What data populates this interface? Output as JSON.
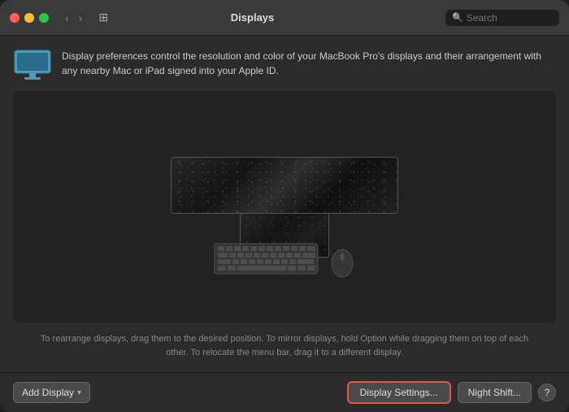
{
  "window": {
    "title": "Displays",
    "search_placeholder": "Search"
  },
  "info_banner": {
    "text": "Display preferences control the resolution and color of your MacBook Pro's displays and their arrangement with any nearby Mac or iPad signed into your Apple ID."
  },
  "instructions": {
    "text": "To rearrange displays, drag them to the desired position. To mirror displays, hold Option while dragging them on top of each other. To relocate the menu bar, drag it to a different display."
  },
  "buttons": {
    "add_display": "Add Display",
    "display_settings": "Display Settings...",
    "night_shift": "Night Shift...",
    "help": "?"
  },
  "nav": {
    "back": "‹",
    "forward": "›"
  }
}
